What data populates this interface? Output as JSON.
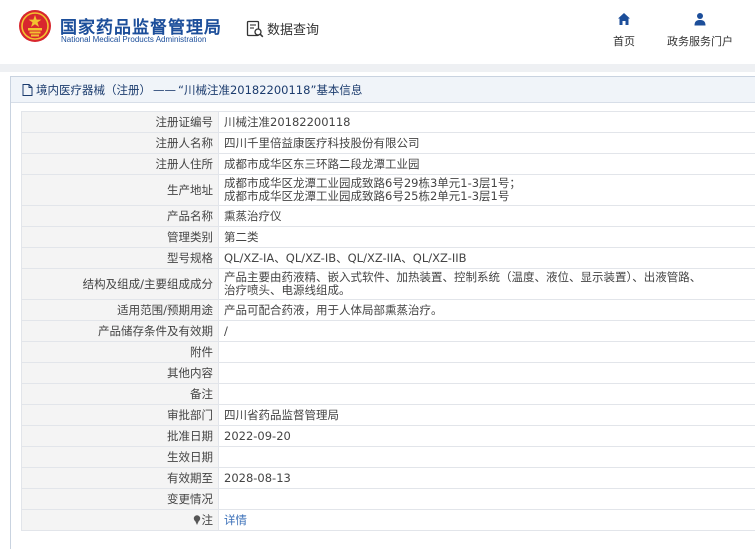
{
  "header": {
    "org_name_cn": "国家药品监督管理局",
    "org_name_en": "National Medical Products Administration",
    "query_label": "数据查询",
    "nav_home": "首页",
    "nav_service": "政务服务门户",
    "brand_color": "#1c4e9a"
  },
  "breadcrumb": {
    "section": "境内医疗器械（注册）",
    "separator": "——",
    "title": "“川械注准20182200118”基本信息"
  },
  "rows": [
    {
      "label": "注册证编号",
      "lines": [
        "川械注准20182200118"
      ]
    },
    {
      "label": "注册人名称",
      "lines": [
        "四川千里倍益康医疗科技股份有限公司"
      ]
    },
    {
      "label": "注册人住所",
      "lines": [
        "成都市成华区东三环路二段龙潭工业园"
      ]
    },
    {
      "label": "生产地址",
      "lines": [
        "成都市成华区龙潭工业园成致路6号29栋3单元1-3层1号；",
        "成都市成华区龙潭工业园成致路6号25栋2单元1-3层1号"
      ]
    },
    {
      "label": "产品名称",
      "lines": [
        "熏蒸治疗仪"
      ]
    },
    {
      "label": "管理类别",
      "lines": [
        "第二类"
      ]
    },
    {
      "label": "型号规格",
      "lines": [
        "QL/XZ-IA、QL/XZ-IB、QL/XZ-IIA、QL/XZ-IIB"
      ]
    },
    {
      "label": "结构及组成/主要组成成分",
      "lines": [
        "产品主要由药液精、嵌入式软件、加热装置、控制系统（温度、液位、显示装置）、出液管路、",
        "治疗喷头、电源线组成。"
      ]
    },
    {
      "label": "适用范围/预期用途",
      "lines": [
        "产品可配合药液，用于人体局部熏蒸治疗。"
      ]
    },
    {
      "label": "产品储存条件及有效期",
      "lines": [
        "/"
      ]
    },
    {
      "label": "附件",
      "lines": [
        ""
      ]
    },
    {
      "label": "其他内容",
      "lines": [
        ""
      ]
    },
    {
      "label": "备注",
      "lines": [
        ""
      ]
    },
    {
      "label": "审批部门",
      "lines": [
        "四川省药品监督管理局"
      ]
    },
    {
      "label": "批准日期",
      "lines": [
        "2022-09-20"
      ]
    },
    {
      "label": "生效日期",
      "lines": [
        ""
      ]
    },
    {
      "label": "有效期至",
      "lines": [
        "2028-08-13"
      ]
    },
    {
      "label": "变更情况",
      "lines": [
        ""
      ]
    },
    {
      "label": "注",
      "lines": [
        "详情"
      ]
    }
  ]
}
